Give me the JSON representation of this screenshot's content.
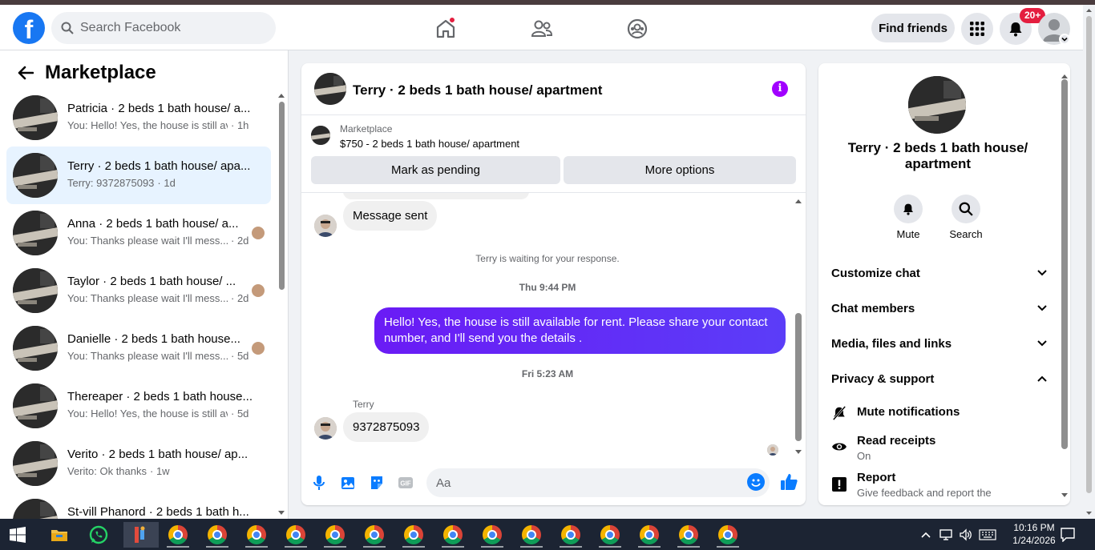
{
  "topnav": {
    "logo_letter": "f",
    "search_placeholder": "Search Facebook",
    "find_friends_label": "Find friends",
    "notification_badge": "20+"
  },
  "left": {
    "title": "Marketplace",
    "conversations": [
      {
        "title": "Patricia · 2 beds 1 bath house/ a...",
        "preview": "You: Hello! Yes, the house is still av...",
        "time": "· 1h",
        "active": false,
        "seen": false
      },
      {
        "title": "Terry · 2 beds 1 bath house/ apa...",
        "preview": "Terry: 9372875093",
        "time": "· 1d",
        "active": true,
        "seen": false
      },
      {
        "title": "Anna · 2 beds 1 bath house/ a...",
        "preview": "You: Thanks please wait I'll mess...",
        "time": "· 2d",
        "active": false,
        "seen": true
      },
      {
        "title": "Taylor · 2 beds 1 bath house/ ...",
        "preview": "You: Thanks please wait I'll mess...",
        "time": "· 2d",
        "active": false,
        "seen": true
      },
      {
        "title": "Danielle · 2 beds 1 bath house...",
        "preview": "You: Thanks please wait I'll mess...",
        "time": "· 5d",
        "active": false,
        "seen": true
      },
      {
        "title": "Thereaper · 2 beds 1 bath house...",
        "preview": "You: Hello! Yes, the house is still av...",
        "time": "· 5d",
        "active": false,
        "seen": false
      },
      {
        "title": "Verito · 2 beds 1 bath house/ ap...",
        "preview": "Verito: Ok thanks",
        "time": "· 1w",
        "active": false,
        "seen": false
      },
      {
        "title": "St-vill Phanord · 2 beds 1 bath h...",
        "preview": "",
        "time": "",
        "active": false,
        "seen": false
      }
    ]
  },
  "chat": {
    "title": "Terry · 2 beds 1 bath house/ apartment",
    "info_glyph": "i",
    "marketplace_label": "Marketplace",
    "listing": "$750 - 2 beds 1 bath house/ apartment",
    "mark_pending_label": "Mark as pending",
    "more_options_label": "More options",
    "msg_sent": "Message sent",
    "waiting_text": "Terry is waiting for your response.",
    "time1": "Thu 9:44 PM",
    "outgoing_text": "Hello! Yes, the house is still available for rent. Please share your contact number, and I'll send you the details .",
    "time2": "Fri 5:23 AM",
    "sender_name": "Terry",
    "incoming_number": "9372875093",
    "composer_placeholder": "Aa"
  },
  "right": {
    "name": "Terry · 2 beds 1 bath house/ apartment",
    "mute_label": "Mute",
    "search_label": "Search",
    "sections": [
      "Customize chat",
      "Chat members",
      "Media, files and links",
      "Privacy & support"
    ],
    "mute_notifications": "Mute notifications",
    "read_receipts": "Read receipts",
    "read_receipts_value": "On",
    "report": "Report",
    "report_sub": "Give feedback and report the"
  },
  "taskbar": {
    "time": "10:16 PM",
    "date": "1/24/2026"
  },
  "colors": {
    "brand": "#1877f2",
    "outgoing_bubble": "#6a1bf5",
    "info_icon": "#a100ff",
    "badge": "#e41e3f"
  }
}
